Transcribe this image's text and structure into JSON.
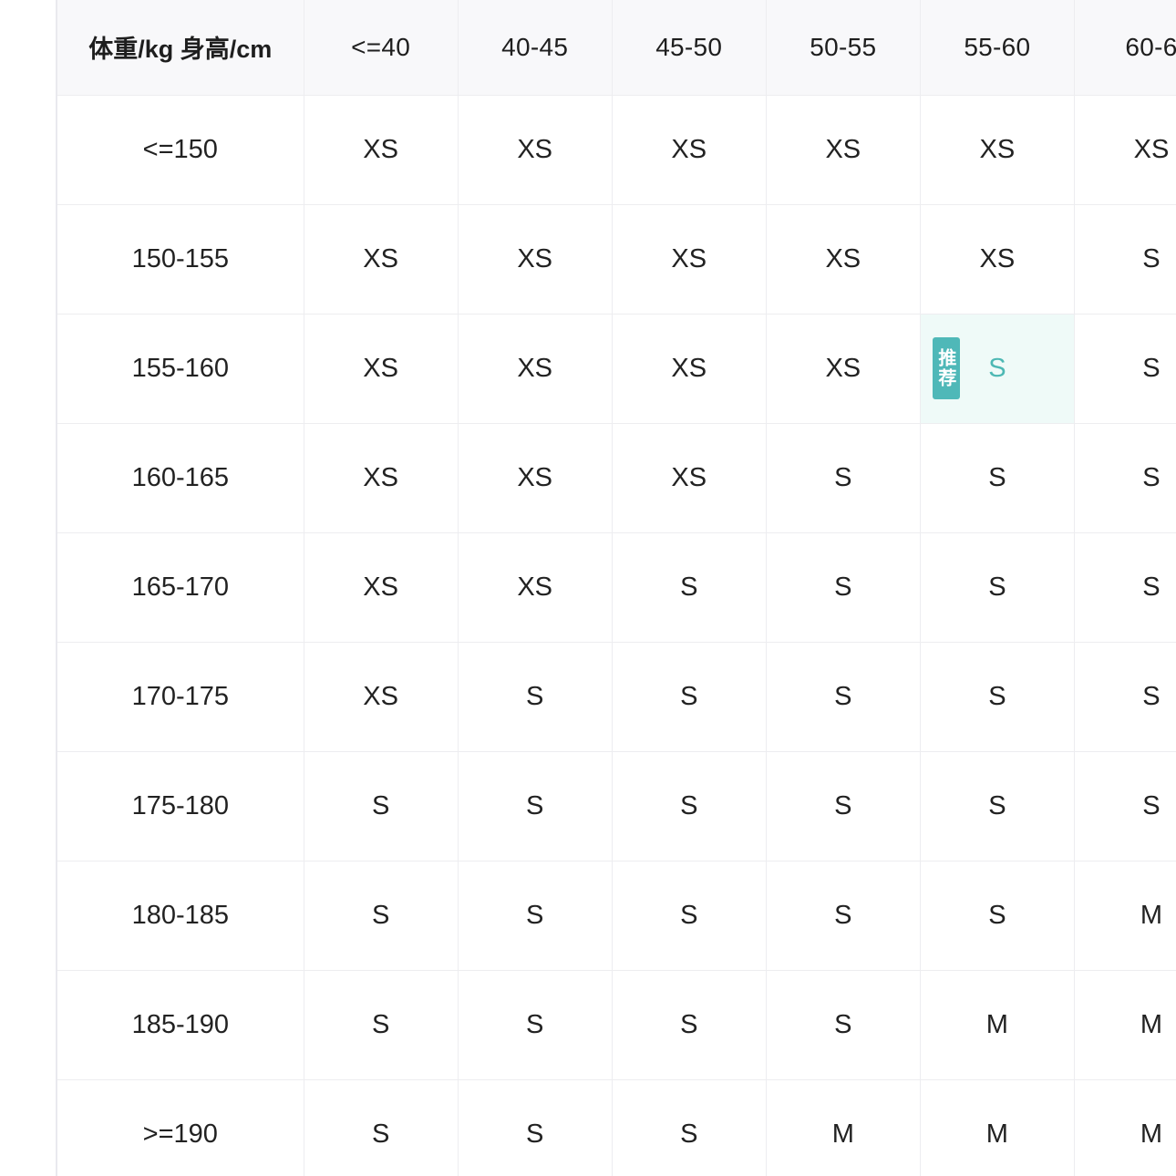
{
  "table": {
    "corner_label": "体重/kg 身高/cm",
    "columns": [
      "<=40",
      "40-45",
      "45-50",
      "50-55",
      "55-60",
      "60-6"
    ],
    "rows": [
      {
        "label": "<=150",
        "cells": [
          "XS",
          "XS",
          "XS",
          "XS",
          "XS",
          "XS"
        ]
      },
      {
        "label": "150-155",
        "cells": [
          "XS",
          "XS",
          "XS",
          "XS",
          "XS",
          "S"
        ]
      },
      {
        "label": "155-160",
        "cells": [
          "XS",
          "XS",
          "XS",
          "XS",
          "S",
          "S"
        ]
      },
      {
        "label": "160-165",
        "cells": [
          "XS",
          "XS",
          "XS",
          "S",
          "S",
          "S"
        ]
      },
      {
        "label": "165-170",
        "cells": [
          "XS",
          "XS",
          "S",
          "S",
          "S",
          "S"
        ]
      },
      {
        "label": "170-175",
        "cells": [
          "XS",
          "S",
          "S",
          "S",
          "S",
          "S"
        ]
      },
      {
        "label": "175-180",
        "cells": [
          "S",
          "S",
          "S",
          "S",
          "S",
          "S"
        ]
      },
      {
        "label": "180-185",
        "cells": [
          "S",
          "S",
          "S",
          "S",
          "S",
          "M"
        ]
      },
      {
        "label": "185-190",
        "cells": [
          "S",
          "S",
          "S",
          "S",
          "M",
          "M"
        ]
      },
      {
        "label": ">=190",
        "cells": [
          "S",
          "S",
          "S",
          "M",
          "M",
          "M"
        ]
      }
    ],
    "recommended": {
      "row": 2,
      "col": 4,
      "badge": "推荐"
    }
  },
  "colors": {
    "header_bg": "#f8f8fa",
    "grid_line": "#ededf0",
    "recommended_bg": "#effaf8",
    "recommended_text": "#4db8b4",
    "badge_bg": "#4fb8b8"
  }
}
